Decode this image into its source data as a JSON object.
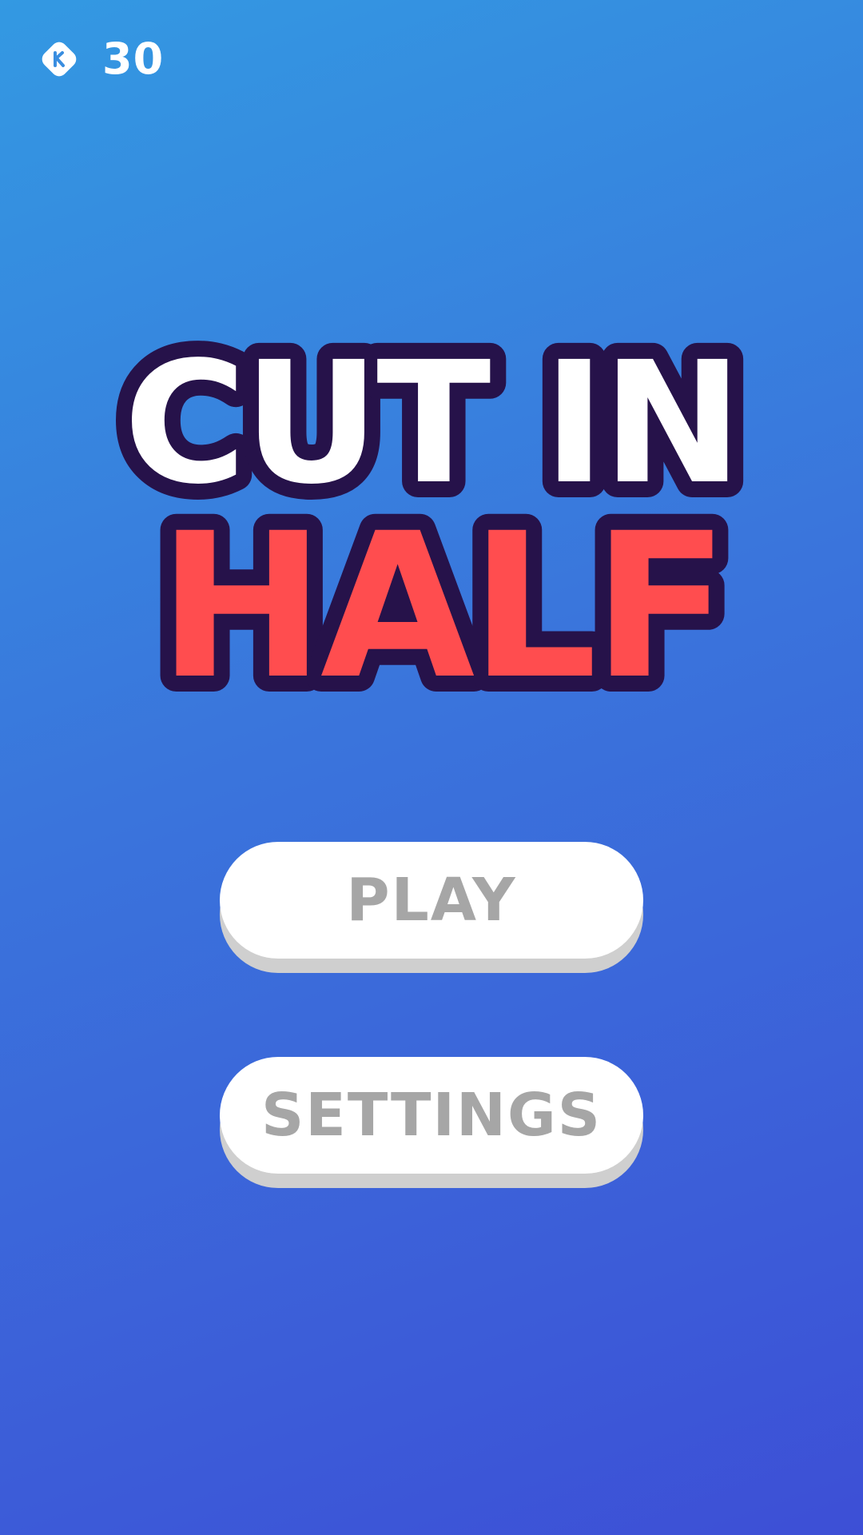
{
  "hud": {
    "coin_icon": "coin-icon",
    "coins": "30"
  },
  "logo": {
    "line1": "CUT IN",
    "line2": "HALF",
    "line1_color": "#ffffff",
    "line2_color": "#ff4d4f",
    "outline_color": "#26124a"
  },
  "menu": {
    "play_label": "PLAY",
    "settings_label": "SETTINGS"
  },
  "colors": {
    "background_top": "#3399e2",
    "background_bottom": "#3d4fd6",
    "button_bg": "#ffffff",
    "button_text": "#a6a6a6",
    "button_shadow": "#cfcfcf"
  }
}
